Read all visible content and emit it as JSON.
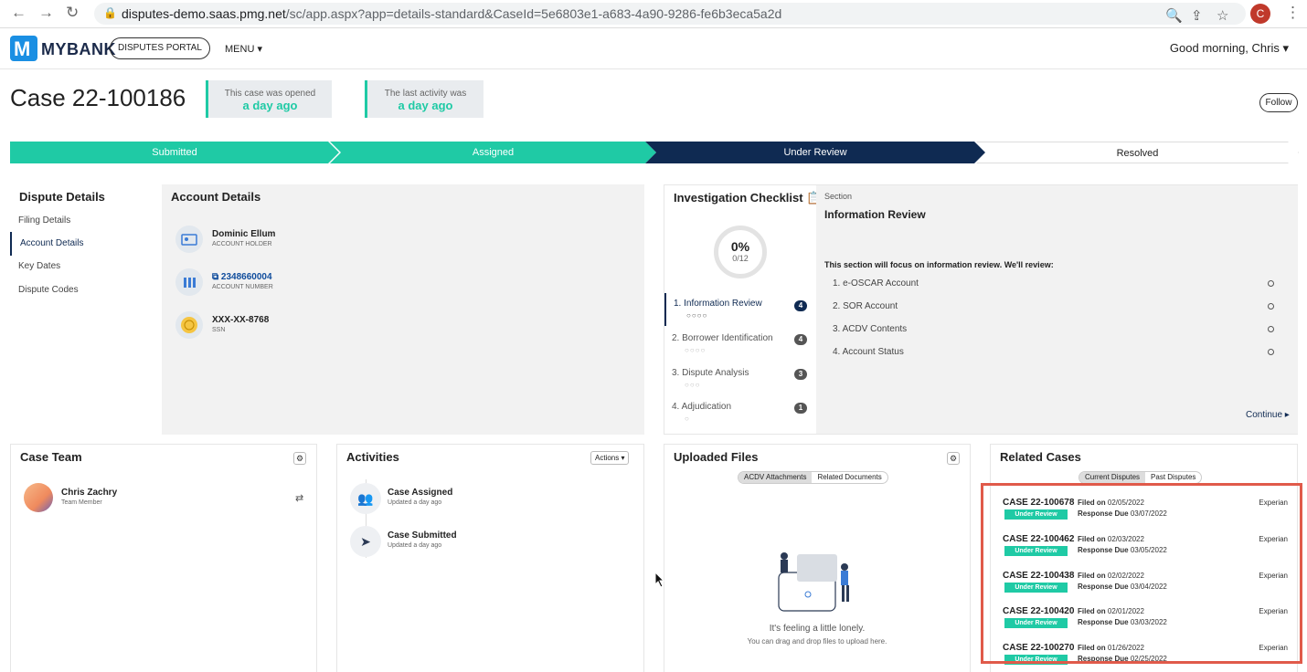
{
  "browser": {
    "url_host": "disputes-demo.saas.pmg.net",
    "url_path": "/sc/app.aspx?app=details-standard&CaseId=5e6803e1-a683-4a90-9286-fe6b3eca5a2d",
    "profile_initial": "C"
  },
  "header": {
    "brand": "MYBANK",
    "portal": "DISPUTES PORTAL",
    "menu": "MENU ▾",
    "greeting": "Good morning, Chris ▾"
  },
  "case": {
    "title": "Case 22-100186",
    "opened_label": "This case was opened",
    "opened_value": "a day ago",
    "activity_label": "The last activity was",
    "activity_value": "a day ago",
    "follow": "Follow"
  },
  "progress": {
    "steps": [
      "Submitted",
      "Assigned",
      "Under Review",
      "Resolved"
    ]
  },
  "dispute_details": {
    "title": "Dispute Details",
    "nav": [
      "Filing Details",
      "Account Details",
      "Key Dates",
      "Dispute Codes"
    ]
  },
  "account_details": {
    "title": "Account Details",
    "holder_name": "Dominic Ellum",
    "holder_label": "ACCOUNT HOLDER",
    "account_number": "2348660004",
    "account_label": "ACCOUNT NUMBER",
    "ssn": "XXX-XX-8768",
    "ssn_label": "SSN"
  },
  "checklist": {
    "title": "Investigation Checklist",
    "percent": "0%",
    "count": "0/12",
    "items": [
      {
        "label": "1.  Information Review",
        "count": "4"
      },
      {
        "label": "2.  Borrower Identification",
        "count": "4"
      },
      {
        "label": "3.  Dispute Analysis",
        "count": "3"
      },
      {
        "label": "4.  Adjudication",
        "count": "1"
      }
    ],
    "section_label": "Section",
    "section_title": "Information Review",
    "section_desc": "This section will focus on information review. We'll review:",
    "section_items": [
      "1.   e-OSCAR Account",
      "2.   SOR Account",
      "3.   ACDV Contents",
      "4.   Account Status"
    ],
    "continue": "Continue ▸"
  },
  "case_team": {
    "title": "Case Team",
    "member_name": "Chris Zachry",
    "member_role": "Team Member"
  },
  "activities": {
    "title": "Activities",
    "actions": "Actions ▾",
    "items": [
      {
        "title": "Case Assigned",
        "sub": "Updated a day ago"
      },
      {
        "title": "Case Submitted",
        "sub": "Updated a day ago"
      }
    ]
  },
  "files": {
    "title": "Uploaded Files",
    "tab1": "ACDV Attachments",
    "tab2": "Related Documents",
    "empty_title": "It's feeling a little lonely.",
    "empty_sub": "You can drag and drop files to upload here."
  },
  "related": {
    "title": "Related Cases",
    "tab1": "Current Disputes",
    "tab2": "Past Disputes",
    "filed_label": "Filed on",
    "due_label": "Response Due",
    "cases": [
      {
        "id": "CASE 22-100678",
        "status": "Under Review",
        "filed": "02/05/2022",
        "due": "03/07/2022",
        "bureau": "Experian"
      },
      {
        "id": "CASE 22-100462",
        "status": "Under Review",
        "filed": "02/03/2022",
        "due": "03/05/2022",
        "bureau": "Experian"
      },
      {
        "id": "CASE 22-100438",
        "status": "Under Review",
        "filed": "02/02/2022",
        "due": "03/04/2022",
        "bureau": "Experian"
      },
      {
        "id": "CASE 22-100420",
        "status": "Under Review",
        "filed": "02/01/2022",
        "due": "03/03/2022",
        "bureau": "Experian"
      },
      {
        "id": "CASE 22-100270",
        "status": "Under Review",
        "filed": "01/26/2022",
        "due": "02/25/2022",
        "bureau": "Experian"
      }
    ]
  },
  "colors": {
    "accent": "#1fcaa5",
    "navy": "#0f2a52",
    "highlight": "#e05a4a"
  }
}
